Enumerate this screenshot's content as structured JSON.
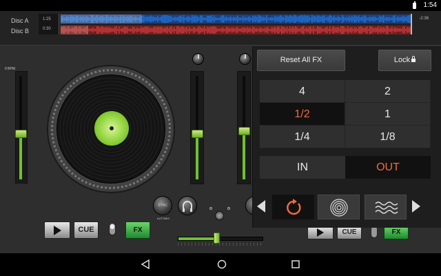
{
  "status_bar": {
    "time": "1:54",
    "battery_icon": "battery-icon"
  },
  "waveform": {
    "disc_a_label": "Disc A",
    "disc_b_label": "Disc B",
    "disc_a_time": "1:25",
    "disc_b_time": "0:30",
    "remaining_time": "-2:38",
    "disc_a_color": "#1f6fd1",
    "disc_b_color": "#c23a3a"
  },
  "left_deck": {
    "bpm_label": "0 BPM",
    "pitch_level": 0.57,
    "play_icon": "play-icon",
    "cue_label": "CUE",
    "fx_label": "FX"
  },
  "mixer": {
    "sync_label": "SYNC",
    "automix_label": "AUTOMIX",
    "headphone_icon": "headphone-icon",
    "channel_a_level": 0.43,
    "channel_b_level": 0.45,
    "crossfader_position": 0.45,
    "accent_color": "#6fc22a"
  },
  "right_deck": {
    "play_icon": "play-icon",
    "cue_label": "CUE",
    "fx_label": "FX"
  },
  "fx_panel": {
    "reset_label": "Reset All FX",
    "lock_label": "Lock",
    "lock_icon": "lock-icon",
    "beats": [
      {
        "label": "4",
        "active": false
      },
      {
        "label": "2",
        "active": false
      },
      {
        "label": "1/2",
        "active": true
      },
      {
        "label": "1",
        "active": false
      },
      {
        "label": "1/4",
        "active": false
      },
      {
        "label": "1/8",
        "active": false
      }
    ],
    "in_label": "IN",
    "out_label": "OUT",
    "active_color": "#f26b3a",
    "effects": [
      {
        "icon": "loop-icon",
        "active": true
      },
      {
        "icon": "vinyl-icon",
        "active": false
      },
      {
        "icon": "wave-icon",
        "active": false
      }
    ],
    "prev_icon": "chevron-left-icon",
    "next_icon": "chevron-right-icon"
  },
  "nav_bar": {
    "back_icon": "back-icon",
    "home_icon": "home-icon",
    "recent_icon": "recent-apps-icon"
  }
}
